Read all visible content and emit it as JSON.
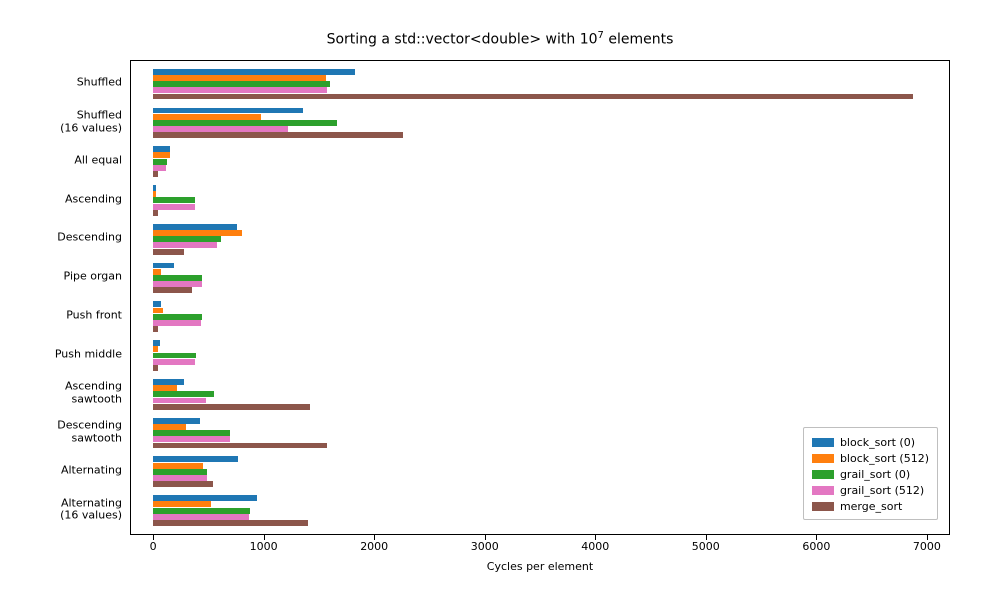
{
  "chart_data": {
    "type": "bar",
    "title": "Sorting a std::vector<double> with 10^7 elements",
    "title_html_prefix": "Sorting a std::vector<double> with 10",
    "title_sup": "7",
    "title_html_suffix": " elements",
    "xlabel": "Cycles per element",
    "ylabel": "",
    "xlim": [
      -200,
      7200
    ],
    "ylim_groups": 12,
    "x_ticks": [
      0,
      1000,
      2000,
      3000,
      4000,
      5000,
      6000,
      7000
    ],
    "categories": [
      "Shuffled",
      "Shuffled\n(16 values)",
      "All equal",
      "Ascending",
      "Descending",
      "Pipe organ",
      "Push front",
      "Push middle",
      "Ascending\nsawtooth",
      "Descending\nsawtooth",
      "Alternating",
      "Alternating\n(16 values)"
    ],
    "series": [
      {
        "name": "block_sort (0)",
        "color": "#1f77b4",
        "values": [
          1830,
          1360,
          150,
          30,
          760,
          190,
          70,
          60,
          280,
          420,
          770,
          940
        ]
      },
      {
        "name": "block_sort (512)",
        "color": "#ff7f0e",
        "values": [
          1560,
          980,
          150,
          30,
          800,
          70,
          90,
          40,
          220,
          300,
          450,
          520
        ]
      },
      {
        "name": "grail_sort (0)",
        "color": "#2ca02c",
        "values": [
          1600,
          1660,
          130,
          380,
          610,
          440,
          440,
          390,
          550,
          700,
          490,
          880
        ]
      },
      {
        "name": "grail_sort (512)",
        "color": "#e377c2",
        "values": [
          1570,
          1220,
          120,
          380,
          580,
          440,
          430,
          380,
          480,
          700,
          490,
          870
        ]
      },
      {
        "name": "merge_sort",
        "color": "#8c564b",
        "values": [
          6870,
          2260,
          40,
          40,
          280,
          350,
          40,
          40,
          1420,
          1570,
          540,
          1400
        ]
      }
    ],
    "legend_position": "lower right"
  }
}
